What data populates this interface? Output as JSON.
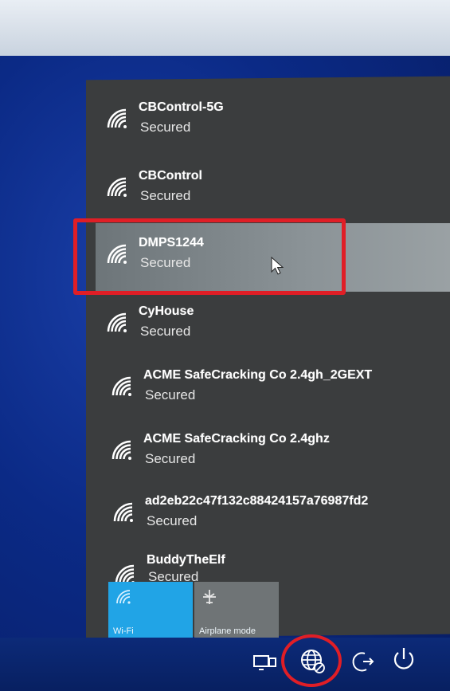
{
  "networks": [
    {
      "ssid": "CBControl-5G",
      "status": "Secured"
    },
    {
      "ssid": "CBControl",
      "status": "Secured"
    },
    {
      "ssid": "DMPS1244",
      "status": "Secured"
    },
    {
      "ssid": "CyHouse",
      "status": "Secured"
    },
    {
      "ssid": "ACME SafeCracking Co 2.4gh_2GEXT",
      "status": "Secured"
    },
    {
      "ssid": "ACME SafeCracking Co 2.4ghz",
      "status": "Secured"
    },
    {
      "ssid": "ad2eb22c47f132c88424157a76987fd2",
      "status": "Secured"
    },
    {
      "ssid": "BuddyTheElf",
      "status": "Secured"
    }
  ],
  "tiles": {
    "wifi": {
      "label": "Wi-Fi",
      "icon": "wifi-icon",
      "active": true
    },
    "airplane": {
      "label": "Airplane mode",
      "icon": "airplane-icon",
      "active": false
    }
  },
  "taskbar": {
    "icons": [
      "project-display-icon",
      "network-globe-icon",
      "sleep-icon",
      "power-icon"
    ]
  },
  "colors": {
    "highlight": "#e01e26",
    "tile_active": "#21a4e6",
    "panel": "#3b3d3e"
  }
}
